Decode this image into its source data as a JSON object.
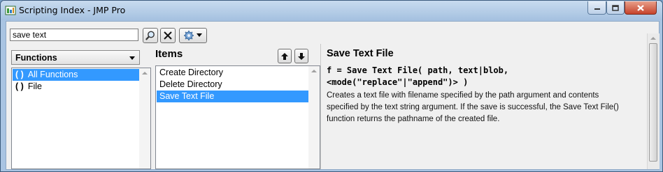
{
  "window": {
    "title": "Scripting Index - JMP Pro"
  },
  "toolbar": {
    "search_value": "save text"
  },
  "filter": {
    "selected": "Functions"
  },
  "categories": [
    {
      "label": "All Functions",
      "selected": true
    },
    {
      "label": "File",
      "selected": false
    }
  ],
  "items_panel": {
    "heading": "Items",
    "items": [
      {
        "label": "Create Directory",
        "selected": false
      },
      {
        "label": "Delete Directory",
        "selected": false
      },
      {
        "label": "Save Text File",
        "selected": true
      }
    ]
  },
  "detail": {
    "title": "Save Text File",
    "syntax_line1": "f = Save Text File( path, text|blob,",
    "syntax_line2": "<mode(\"replace\"|\"append\")> )",
    "description": "Creates a text file with filename specified by the path argument and contents specified by the text string argument. If the save is successful, the Save Text File() function returns the pathname of the created file."
  },
  "colors": {
    "selection": "#3399ff",
    "close_button": "#c6432c"
  }
}
